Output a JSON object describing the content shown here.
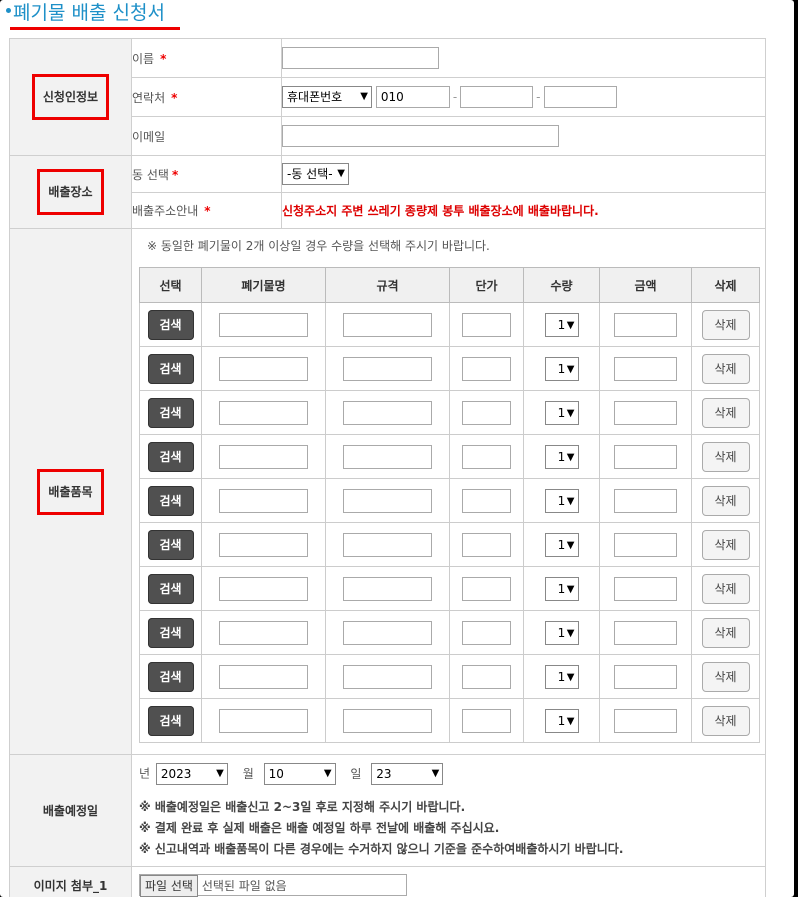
{
  "page_title": "폐기물 배출 신청서",
  "sections": {
    "applicant": "신청인정보",
    "location": "배출장소",
    "items": "배출품목",
    "date": "배출예정일",
    "image": "이미지 첨부_1"
  },
  "applicant": {
    "name_label": "이름",
    "name_value": "",
    "phone_label": "연락처",
    "phone_type": "휴대폰번호",
    "phone_prefix": "010",
    "phone_mid": "",
    "phone_last": "",
    "phone_dash": "-",
    "email_label": "이메일",
    "email_value": ""
  },
  "required_mark": "*",
  "location": {
    "dong_label": "동 선택",
    "dong_value": "-동 선택-",
    "guide_label": "배출주소안내",
    "guide_text": "신청주소지 주변 쓰레기 종량제 봉투 배출장소에 배출바랍니다."
  },
  "items": {
    "notice": "※ 동일한 폐기물이 2개 이상일 경우 수량을 선택해 주시기 바랍니다.",
    "headers": [
      "선택",
      "폐기물명",
      "규격",
      "단가",
      "수량",
      "금액",
      "삭제"
    ],
    "search_label": "검색",
    "delete_label": "삭제",
    "rows": [
      {
        "qty": "1"
      },
      {
        "qty": "1"
      },
      {
        "qty": "1"
      },
      {
        "qty": "1"
      },
      {
        "qty": "1"
      },
      {
        "qty": "1"
      },
      {
        "qty": "1"
      },
      {
        "qty": "1"
      },
      {
        "qty": "1"
      },
      {
        "qty": "1"
      }
    ]
  },
  "date": {
    "year_label": "년",
    "year": "2023",
    "month_label": "월",
    "month": "10",
    "day_label": "일",
    "day": "23",
    "notes": [
      "※ 배출예정일은 배출신고 2~3일 후로 지정해 주시기 바랍니다.",
      "※ 결제 완료 후 실제 배출은 배출 예정일 하루 전날에 배출해 주십시요.",
      "※ 신고내역과 배출품목이 다른 경우에는 수거하지 않으니 기준을 준수하여배출하시기 바랍니다."
    ]
  },
  "file": {
    "button": "파일 선택",
    "status": "선택된 파일 없음"
  },
  "colors": {
    "accent": "#1e90c8",
    "highlight": "#ee0000",
    "search_button": "#505050"
  }
}
